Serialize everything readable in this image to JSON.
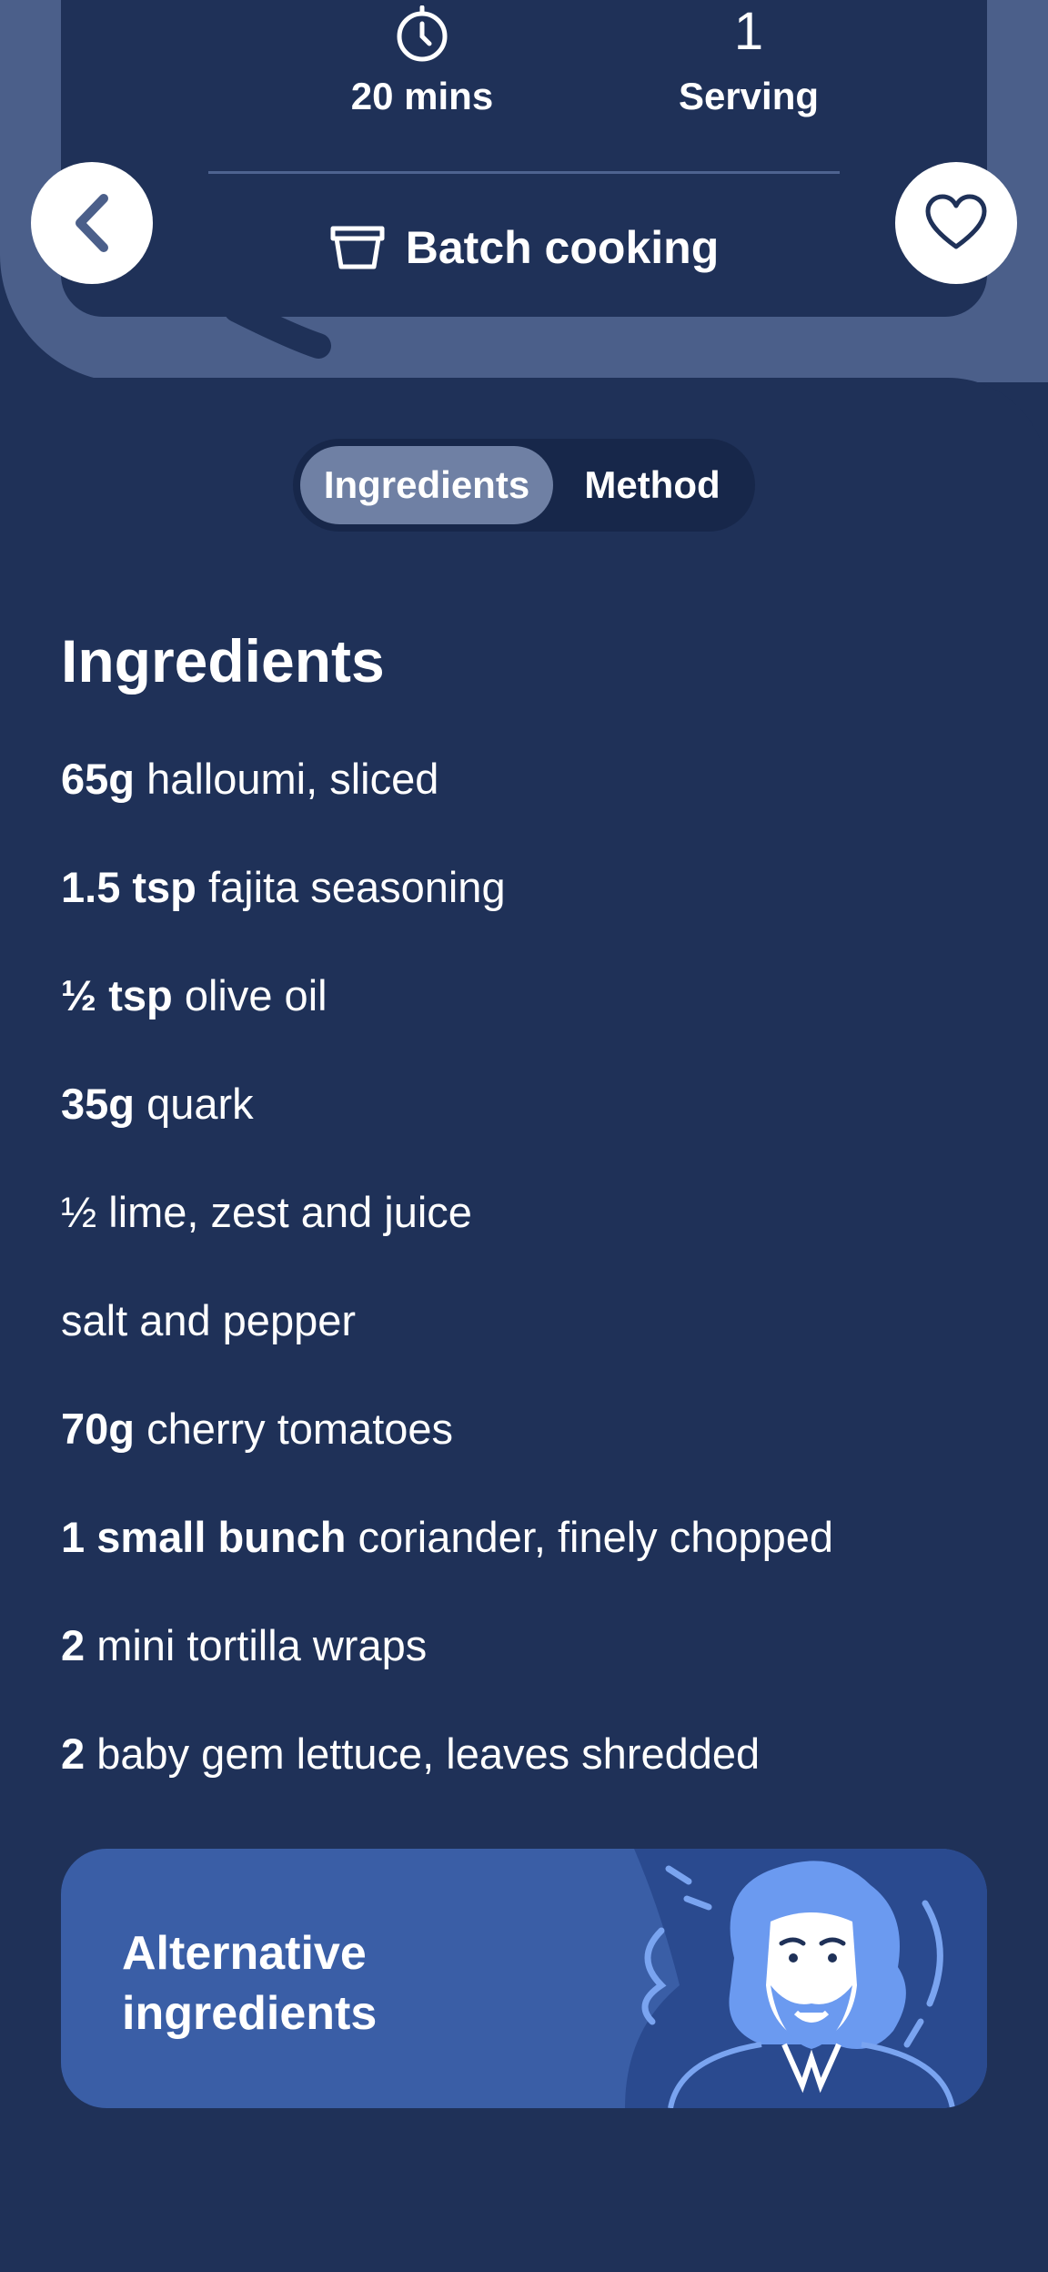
{
  "recipe_info": {
    "time_value": "20 mins",
    "serving_count": "1",
    "serving_label": "Serving",
    "category_label": "Batch cooking"
  },
  "tabs": [
    {
      "label": "Ingredients",
      "selected": true
    },
    {
      "label": "Method",
      "selected": false
    }
  ],
  "ingredients_section": {
    "title": "Ingredients",
    "items": [
      {
        "quantity": "65g",
        "name": "halloumi, sliced"
      },
      {
        "quantity": "1.5 tsp",
        "name": "fajita seasoning"
      },
      {
        "quantity": "½ tsp",
        "name": "olive oil"
      },
      {
        "quantity": "35g",
        "name": "quark"
      },
      {
        "quantity": "",
        "name": "½ lime, zest and juice"
      },
      {
        "quantity": "",
        "name": "salt and pepper"
      },
      {
        "quantity": "70g",
        "name": "cherry tomatoes"
      },
      {
        "quantity": "1 small bunch",
        "name": "coriander, finely chopped"
      },
      {
        "quantity": "2",
        "name": "mini tortilla wraps"
      },
      {
        "quantity": "2",
        "name": "baby gem lettuce, leaves shredded"
      }
    ]
  },
  "alternative_banner": {
    "line1": "Alternative",
    "line2": "ingredients"
  },
  "icons": {
    "back": "chevron-left-icon",
    "favorite": "heart-icon",
    "timer": "stopwatch-icon",
    "batch": "container-icon"
  },
  "colors": {
    "background": "#1f3158",
    "header_background": "#4b5f8a",
    "tab_active": "#6f80a4",
    "banner": "#3a5ea6",
    "accent_icon": "#4b5f8a"
  }
}
